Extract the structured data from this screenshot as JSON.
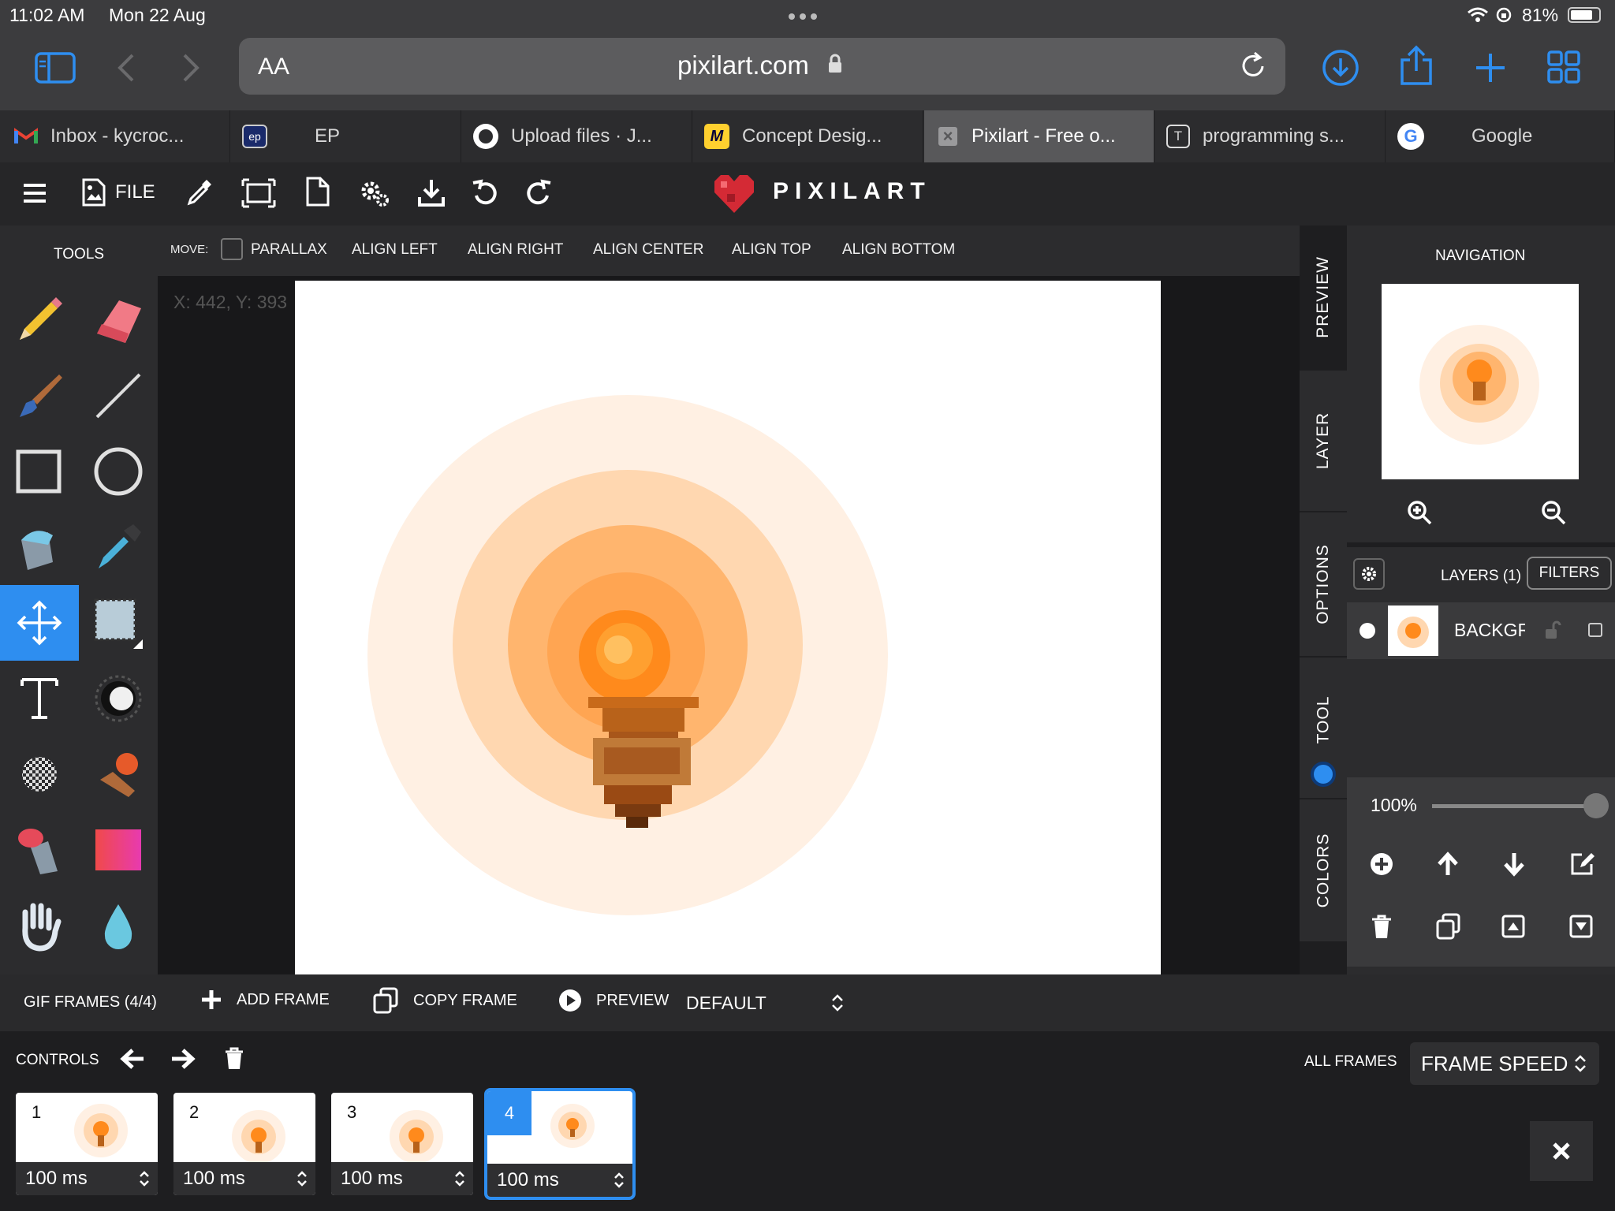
{
  "status": {
    "time": "11:02 AM",
    "date": "Mon 22 Aug",
    "battery": "81%"
  },
  "browser": {
    "aa_label": "AA",
    "url": "pixilart.com"
  },
  "tabs": [
    {
      "label": "Inbox - kycroc...",
      "icon": "gmail-icon"
    },
    {
      "label": "EP",
      "icon": "ep-icon"
    },
    {
      "label": "Upload files · J...",
      "icon": "github-icon"
    },
    {
      "label": "Concept Desig...",
      "icon": "miro-icon"
    },
    {
      "label": "Pixilart - Free o...",
      "icon": "close-icon",
      "active": true
    },
    {
      "label": "programming s...",
      "icon": "t-icon"
    },
    {
      "label": "Google",
      "icon": "google-icon"
    }
  ],
  "header": {
    "file_label": "FILE",
    "brand": "PIXILART"
  },
  "tools": {
    "title": "TOOLS"
  },
  "movebar": {
    "move_label": "MOVE:",
    "parallax": "PARALLAX",
    "align_left": "ALIGN LEFT",
    "align_right": "ALIGN RIGHT",
    "align_center": "ALIGN CENTER",
    "align_top": "ALIGN TOP",
    "align_bottom": "ALIGN BOTTOM"
  },
  "canvas": {
    "coords": "X: 442, Y: 393"
  },
  "sidetabs": {
    "preview": "PREVIEW",
    "layer": "LAYER",
    "options": "OPTIONS",
    "tool": "TOOL",
    "colors": "COLORS"
  },
  "navigation": {
    "title": "NAVIGATION"
  },
  "layers": {
    "title": "LAYERS (1)",
    "filters": "FILTERS",
    "layer_name": "BACKGR(",
    "opacity": "100%",
    "opacity_value": 1.0
  },
  "gif": {
    "frames_label": "GIF FRAMES (4/4)",
    "add_frame": "ADD FRAME",
    "copy_frame": "COPY FRAME",
    "preview": "PREVIEW",
    "mode": "DEFAULT"
  },
  "controls": {
    "label": "CONTROLS",
    "all_frames": "ALL FRAMES",
    "frame_speed": "FRAME SPEED"
  },
  "frames": [
    {
      "number": "1",
      "duration": "100 ms"
    },
    {
      "number": "2",
      "duration": "100 ms"
    },
    {
      "number": "3",
      "duration": "100 ms"
    },
    {
      "number": "4",
      "duration": "100 ms",
      "selected": true
    }
  ],
  "colors": {
    "accent": "#2e8ef0",
    "glow_outer": "#fff0e3",
    "glow_mid": "#ffd7b0",
    "glow_inner": "#ffb56e",
    "flame": "#ff8a1c",
    "torch_body": "#b8621a"
  }
}
